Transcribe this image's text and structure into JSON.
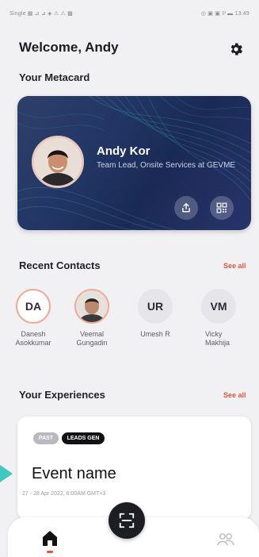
{
  "status_bar": {
    "left_text": "Single ▦ ⊿ ⊿ ◈ ⚠ ⚠ ▩",
    "right_text": "◎ ▣ ▣ ⅌ ▬ 13:49"
  },
  "header": {
    "title": "Welcome, Andy",
    "settings_icon": "gear-icon"
  },
  "metacard": {
    "section_label": "Your Metacard",
    "name": "Andy Kor",
    "role": "Team Lead, Onsite Services at GEVME",
    "share_icon": "share-icon",
    "qr_icon": "qr-code-icon"
  },
  "recent_contacts": {
    "section_label": "Recent Contacts",
    "see_all": "See all",
    "items": [
      {
        "initials": "DA",
        "name": "Danesh Asokkumar"
      },
      {
        "initials": "",
        "name": "Veemal Gungadin"
      },
      {
        "initials": "UR",
        "name": "Umesh R"
      },
      {
        "initials": "VM",
        "name": "Vicky Makhija"
      }
    ]
  },
  "experiences": {
    "section_label": "Your Experiences",
    "see_all": "See all",
    "badges": [
      "PAST",
      "LEADS GEN"
    ],
    "event_name": "Event name",
    "event_date": "27 - 28 Apr 2022, 6:00AM GMT+3"
  },
  "bottom_nav": {
    "home_icon": "home-icon",
    "scan_icon": "scan-icon",
    "people_icon": "people-icon"
  },
  "colors": {
    "accent": "#e2563f",
    "card_bg": "#223666",
    "background": "#f1f0f3",
    "arrow": "#3ec9c0"
  }
}
